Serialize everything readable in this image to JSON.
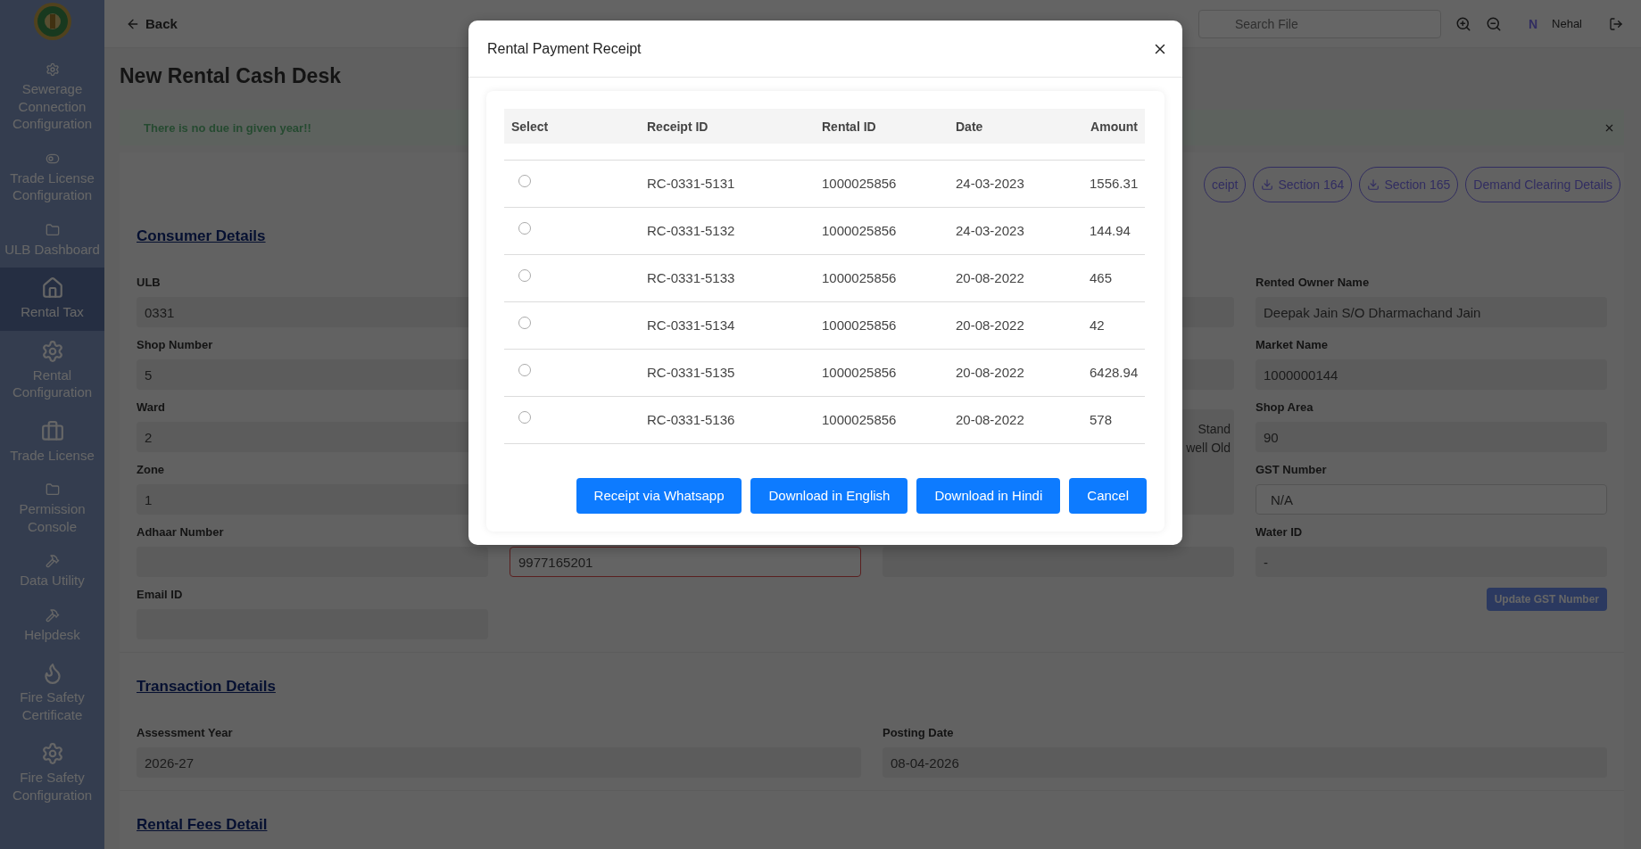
{
  "sidebar": {
    "items": [
      {
        "label": "Sewerage Connection Configuration",
        "selected": false
      },
      {
        "label": "Trade License Configuration",
        "selected": false
      },
      {
        "label": "ULB Dashboard",
        "selected": false
      },
      {
        "label": "Rental Tax",
        "selected": true
      },
      {
        "label": "Rental Configuration",
        "selected": false
      },
      {
        "label": "Trade License",
        "selected": false
      },
      {
        "label": "Permission Console",
        "selected": false
      },
      {
        "label": "Data Utility",
        "selected": false
      },
      {
        "label": "Helpdesk",
        "selected": false
      },
      {
        "label": "Fire Safety Certificate",
        "selected": false
      },
      {
        "label": "Fire Safety Configuration",
        "selected": false
      }
    ]
  },
  "topbar": {
    "back": "Back",
    "search": {
      "placeholder": "Search File"
    },
    "user": {
      "initial": "N",
      "name": "Nehal"
    }
  },
  "page_title": "New Rental Cash Desk",
  "alert": {
    "message": "There is no due in given year!!"
  },
  "actions": [
    {
      "label": "ceipt",
      "kind": "plain"
    },
    {
      "label": "Section 164",
      "kind": "download"
    },
    {
      "label": "Section 165",
      "kind": "download"
    },
    {
      "label": "Demand Clearing Details",
      "kind": "plain"
    }
  ],
  "consumer_details": {
    "title": "Consumer Details",
    "fields": [
      {
        "kind": "field",
        "label": "ULB",
        "value": "0331"
      },
      {
        "kind": "gap"
      },
      {
        "kind": "field"
      },
      {
        "kind": "field",
        "label": "Rented Owner Name",
        "value": "Deepak Jain S/O Dharmachand Jain"
      },
      {
        "kind": "field",
        "label": "Shop Number",
        "value": "5"
      },
      {
        "kind": "gap"
      },
      {
        "kind": "field"
      },
      {
        "kind": "field",
        "label": "Market Name",
        "value": "1000000144"
      },
      {
        "kind": "field",
        "label": "Ward",
        "value": "2"
      },
      {
        "kind": "gap"
      },
      {
        "kind": "textarea",
        "lines": [
          "Stand",
          "well Old"
        ]
      },
      {
        "kind": "field",
        "label": "Shop Area",
        "value": "90"
      },
      {
        "kind": "field",
        "label": "Zone",
        "value": "1"
      },
      {
        "kind": "gap"
      },
      {
        "kind": "input",
        "label": "GST Number",
        "value": "N/A"
      },
      {
        "kind": "field",
        "label": "Adhaar Number"
      },
      {
        "kind": "error",
        "value": "9977165201"
      },
      {
        "kind": "field"
      },
      {
        "kind": "field",
        "label": "Water ID",
        "value": "-"
      },
      {
        "kind": "field",
        "label": "Email ID"
      },
      {
        "kind": "button",
        "label": "Update GST Number"
      }
    ]
  },
  "transaction_details": {
    "title": "Transaction Details",
    "fields": [
      {
        "label": "Assessment Year",
        "value": "2026-27"
      },
      {
        "label": "Posting Date",
        "value": "08-04-2026"
      }
    ]
  },
  "rental_fees": {
    "title": "Rental Fees Detail"
  },
  "modal": {
    "title": "Rental Payment Receipt",
    "select_header": "Select",
    "columns": [
      "Receipt ID",
      "Rental ID",
      "Date",
      "Amount"
    ],
    "rows": [
      {
        "selected": false,
        "cells": [
          "RC-0331-5131",
          "1000025856",
          "24-03-2023",
          "1556.31"
        ]
      },
      {
        "selected": false,
        "cells": [
          "RC-0331-5132",
          "1000025856",
          "24-03-2023",
          "144.94"
        ]
      },
      {
        "selected": false,
        "cells": [
          "RC-0331-5133",
          "1000025856",
          "20-08-2022",
          "465"
        ]
      },
      {
        "selected": false,
        "cells": [
          "RC-0331-5134",
          "1000025856",
          "20-08-2022",
          "42"
        ]
      },
      {
        "selected": false,
        "cells": [
          "RC-0331-5135",
          "1000025856",
          "20-08-2022",
          "6428.94"
        ]
      },
      {
        "selected": false,
        "cells": [
          "RC-0331-5136",
          "1000025856",
          "20-08-2022",
          "578"
        ]
      }
    ],
    "buttons": [
      "Receipt via Whatsapp",
      "Download in English",
      "Download in Hindi",
      "Cancel"
    ]
  }
}
